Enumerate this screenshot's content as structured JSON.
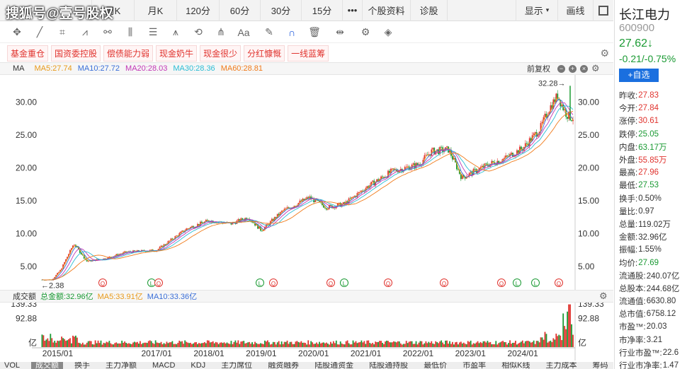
{
  "watermark": "搜狐号@壹号股权",
  "tabs": [
    "周K",
    "月K",
    "120分",
    "60分",
    "30分",
    "15分",
    "•••",
    "个股资料",
    "诊股"
  ],
  "tabs_right": {
    "show": "显示",
    "draw": "画线"
  },
  "tags": [
    "基金重仓",
    "国资委控股",
    "偿债能力弱",
    "现金奶牛",
    "现金很少",
    "分红慷慨",
    "一线蓝筹"
  ],
  "ma_bar": {
    "label": "MA",
    "ma5": "MA5:27.74",
    "ma10": "MA10:27.72",
    "ma20": "MA20:28.03",
    "ma30": "MA30:28.36",
    "ma60": "MA60:28.81",
    "fuquan": "前复权"
  },
  "vol_bar": {
    "label": "成交额",
    "total": "总金额:32.96亿",
    "ma5": "MA5:33.91亿",
    "ma10": "MA10:33.36亿"
  },
  "annotations": {
    "high": "32.28→",
    "low": "←2.38"
  },
  "vol_unit": "亿",
  "bottom_tabs": [
    "VOL",
    "成交额",
    "换手",
    "主力净额",
    "MACD",
    "KDJ",
    "主力席位",
    "融资融券",
    "陆股通资金",
    "陆股通持股",
    "最低价",
    "市盈率",
    "相似K线",
    "主力成本",
    "筹码"
  ],
  "stock": {
    "name": "长江电力",
    "code": "600900",
    "price": "27.62↓",
    "change": "-0.21/-0.75%",
    "add": "+自选"
  },
  "quote": [
    {
      "k": "昨收:",
      "v": "27.83",
      "c": "red"
    },
    {
      "k": "今开:",
      "v": "27.84",
      "c": "red"
    },
    {
      "k": "涨停:",
      "v": "30.61",
      "c": "red"
    },
    {
      "k": "跌停:",
      "v": "25.05",
      "c": "green"
    },
    {
      "k": "内盘:",
      "v": "63.17万",
      "c": "green"
    },
    {
      "k": "外盘:",
      "v": "55.85万",
      "c": "red"
    },
    {
      "k": "最高:",
      "v": "27.96",
      "c": "red"
    },
    {
      "k": "最低:",
      "v": "27.53",
      "c": "green"
    },
    {
      "k": "换手:",
      "v": "0.50%",
      "c": ""
    },
    {
      "k": "量比:",
      "v": "0.97",
      "c": ""
    },
    {
      "k": "总量:",
      "v": "119.02万",
      "c": ""
    },
    {
      "k": "金额:",
      "v": "32.96亿",
      "c": ""
    },
    {
      "k": "振幅:",
      "v": "1.55%",
      "c": ""
    },
    {
      "k": "均价:",
      "v": "27.69",
      "c": "green"
    },
    {
      "k": "流通股:",
      "v": "240.07亿",
      "c": ""
    },
    {
      "k": "总股本:",
      "v": "244.68亿",
      "c": ""
    },
    {
      "k": "流通值:",
      "v": "6630.80",
      "c": ""
    },
    {
      "k": "总市值:",
      "v": "6758.12",
      "c": ""
    },
    {
      "k": "市盈™:",
      "v": "20.03",
      "c": ""
    },
    {
      "k": "市净率:",
      "v": "3.21",
      "c": ""
    },
    {
      "k": "行业市盈™:",
      "v": "22.6",
      "c": ""
    },
    {
      "k": "行业市净率:",
      "v": "1.47",
      "c": ""
    }
  ],
  "colors": {
    "up": "#e0332e",
    "down": "#1a9a33",
    "ma5": "#e89a1a",
    "ma10": "#3a6fd8",
    "ma20": "#c236b5",
    "ma30": "#2bbcd4",
    "ma60": "#f07a1a"
  },
  "chart_data": {
    "type": "candlestick",
    "title": "",
    "xlabel": "",
    "ylabel": "",
    "x_ticks": [
      "2015/01",
      "2017/01",
      "2018/01",
      "2019/01",
      "2020/01",
      "2021/01",
      "2022/01",
      "2023/01",
      "2024/01"
    ],
    "y_ticks": [
      5.0,
      10.0,
      15.0,
      20.0,
      25.0,
      30.0
    ],
    "y_tick_labels": [
      "5.00",
      "10.00",
      "15.00",
      "20.00",
      "25.00",
      "30.00"
    ],
    "ylim": [
      2.0,
      33.5
    ],
    "vol_ticks": [
      "139.33",
      "92.88"
    ],
    "vol_ylim": [
      0,
      139.33
    ],
    "price_path": [
      {
        "date": "2015/01",
        "close": 3.0
      },
      {
        "date": "2015/03",
        "close": 4.5
      },
      {
        "date": "2015/06",
        "close": 8.5
      },
      {
        "date": "2015/09",
        "close": 5.8
      },
      {
        "date": "2016/01",
        "close": 6.2
      },
      {
        "date": "2016/06",
        "close": 7.2
      },
      {
        "date": "2017/01",
        "close": 7.5
      },
      {
        "date": "2017/08",
        "close": 10.8
      },
      {
        "date": "2018/01",
        "close": 12.0
      },
      {
        "date": "2018/06",
        "close": 11.5
      },
      {
        "date": "2018/10",
        "close": 12.5
      },
      {
        "date": "2019/01",
        "close": 10.5
      },
      {
        "date": "2019/06",
        "close": 13.5
      },
      {
        "date": "2019/12",
        "close": 15.5
      },
      {
        "date": "2020/04",
        "close": 14.0
      },
      {
        "date": "2020/08",
        "close": 14.5
      },
      {
        "date": "2021/01",
        "close": 17.0
      },
      {
        "date": "2021/07",
        "close": 19.5
      },
      {
        "date": "2022/01",
        "close": 20.5
      },
      {
        "date": "2022/04",
        "close": 22.5
      },
      {
        "date": "2022/08",
        "close": 22.8
      },
      {
        "date": "2022/11",
        "close": 18.5
      },
      {
        "date": "2023/05",
        "close": 20.5
      },
      {
        "date": "2023/09",
        "close": 21.5
      },
      {
        "date": "2024/01",
        "close": 23.0
      },
      {
        "date": "2024/05",
        "close": 26.0
      },
      {
        "date": "2024/07",
        "close": 29.0
      },
      {
        "date": "2024/09",
        "close": 31.0
      },
      {
        "date": "2024/10",
        "close": 29.5
      },
      {
        "date": "2024/11",
        "close": 28.2
      },
      {
        "date": "2024/12",
        "close": 27.62
      }
    ],
    "high": {
      "value": 32.28
    },
    "low": {
      "value": 2.38
    },
    "series": [
      {
        "name": "MA5",
        "value": 27.74
      },
      {
        "name": "MA10",
        "value": 27.72
      },
      {
        "name": "MA20",
        "value": 28.03
      },
      {
        "name": "MA30",
        "value": 28.36
      },
      {
        "name": "MA60",
        "value": 28.81
      }
    ],
    "legend": "top-left",
    "grid": false
  }
}
